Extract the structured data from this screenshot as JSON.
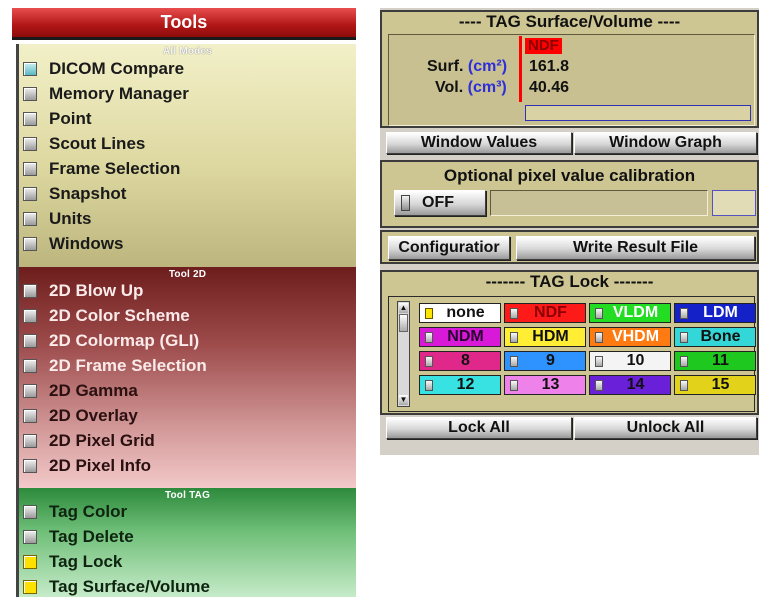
{
  "tools": {
    "title": "Tools",
    "sections": [
      {
        "header": "All Modes",
        "items": [
          {
            "label": "DICOM Compare",
            "state": "blue"
          },
          {
            "label": "Memory Manager",
            "state": "off"
          },
          {
            "label": "Point",
            "state": "off"
          },
          {
            "label": "Scout Lines",
            "state": "off"
          },
          {
            "label": "Frame Selection",
            "state": "off"
          },
          {
            "label": "Snapshot",
            "state": "off"
          },
          {
            "label": "Units",
            "state": "off"
          },
          {
            "label": "Windows",
            "state": "off"
          }
        ]
      },
      {
        "header": "Tool 2D",
        "items": [
          {
            "label": "2D Blow Up",
            "state": "off"
          },
          {
            "label": "2D Color Scheme",
            "state": "off"
          },
          {
            "label": "2D Colormap (GLI)",
            "state": "off"
          },
          {
            "label": "2D Frame Selection",
            "state": "off"
          },
          {
            "label": "2D Gamma",
            "state": "off"
          },
          {
            "label": "2D Overlay",
            "state": "off"
          },
          {
            "label": "2D Pixel Grid",
            "state": "off"
          },
          {
            "label": "2D Pixel Info",
            "state": "off"
          }
        ]
      },
      {
        "header": "Tool TAG",
        "items": [
          {
            "label": "Tag Color",
            "state": "off"
          },
          {
            "label": "Tag Delete",
            "state": "off"
          },
          {
            "label": "Tag Lock",
            "state": "yellow"
          },
          {
            "label": "Tag Surface/Volume",
            "state": "yellow"
          }
        ]
      }
    ]
  },
  "surface_volume": {
    "title": "---- TAG Surface/Volume ----",
    "tag_name": "NDF",
    "tag_color": "#ff0000",
    "surf_label": "Surf.",
    "surf_unit": "(cm²)",
    "surf_value": "161.8",
    "vol_label": "Vol.",
    "vol_unit": "(cm³)",
    "vol_value": "40.46",
    "window_values_label": "Window Values",
    "window_graph_label": "Window Graph"
  },
  "calibration": {
    "title": "Optional pixel value calibration",
    "toggle_label": "OFF",
    "configuration_label": "Configuratior",
    "write_result_label": "Write Result File"
  },
  "tag_lock": {
    "title": "------- TAG Lock -------",
    "tags": [
      {
        "label": "none",
        "color": "#ffffff",
        "text_color": "#111111",
        "checked": true
      },
      {
        "label": "NDF",
        "color": "#ff1a1a",
        "text_color": "#8b0000",
        "checked": false
      },
      {
        "label": "VLDM",
        "color": "#22dd22",
        "text_color": "#ffffff",
        "checked": false
      },
      {
        "label": "LDM",
        "color": "#1420c8",
        "text_color": "#ffffff",
        "checked": false
      },
      {
        "label": "NDM",
        "color": "#d81ad8",
        "text_color": "#2a0030",
        "checked": false
      },
      {
        "label": "HDM",
        "color": "#ffee33",
        "text_color": "#111111",
        "checked": false
      },
      {
        "label": "VHDM",
        "color": "#ff7a10",
        "text_color": "#ffffff",
        "checked": false
      },
      {
        "label": "Bone",
        "color": "#33d7d7",
        "text_color": "#111111",
        "checked": false
      },
      {
        "label": "8",
        "color": "#e0288a",
        "text_color": "#111111",
        "checked": false
      },
      {
        "label": "9",
        "color": "#2e92ff",
        "text_color": "#111111",
        "checked": false
      },
      {
        "label": "10",
        "color": "#f4f4f4",
        "text_color": "#111111",
        "checked": false
      },
      {
        "label": "11",
        "color": "#1fc81f",
        "text_color": "#111111",
        "checked": false
      },
      {
        "label": "12",
        "color": "#38e2e2",
        "text_color": "#111111",
        "checked": false
      },
      {
        "label": "13",
        "color": "#ee82ea",
        "text_color": "#111111",
        "checked": false
      },
      {
        "label": "14",
        "color": "#6a1fd8",
        "text_color": "#111111",
        "checked": false
      },
      {
        "label": "15",
        "color": "#e2d21a",
        "text_color": "#111111",
        "checked": false
      }
    ],
    "lock_all_label": "Lock All",
    "unlock_all_label": "Unlock All"
  }
}
